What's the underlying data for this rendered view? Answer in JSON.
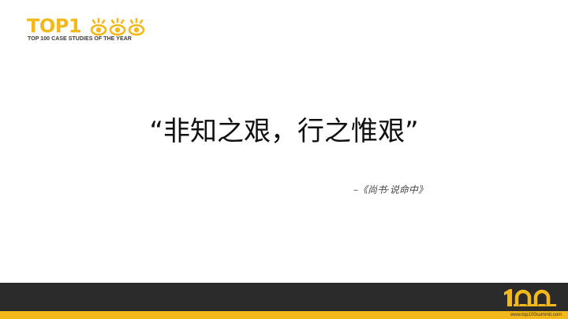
{
  "logo": {
    "wordmark": "TOP1",
    "eyes_icon": "eyes-icon",
    "tagline": "TOP 100 CASE STUDIES OF THE YEAR",
    "color": "#F3B81A"
  },
  "quote": {
    "text": "“非知之艰，行之惟艰”",
    "source": "–《尚书·说命中》"
  },
  "footer": {
    "logo_icon": "100-logo-icon",
    "url": "www.top100summit.com",
    "bar_color": "#2b2b2b",
    "stripe_color": "#F3B81A"
  }
}
